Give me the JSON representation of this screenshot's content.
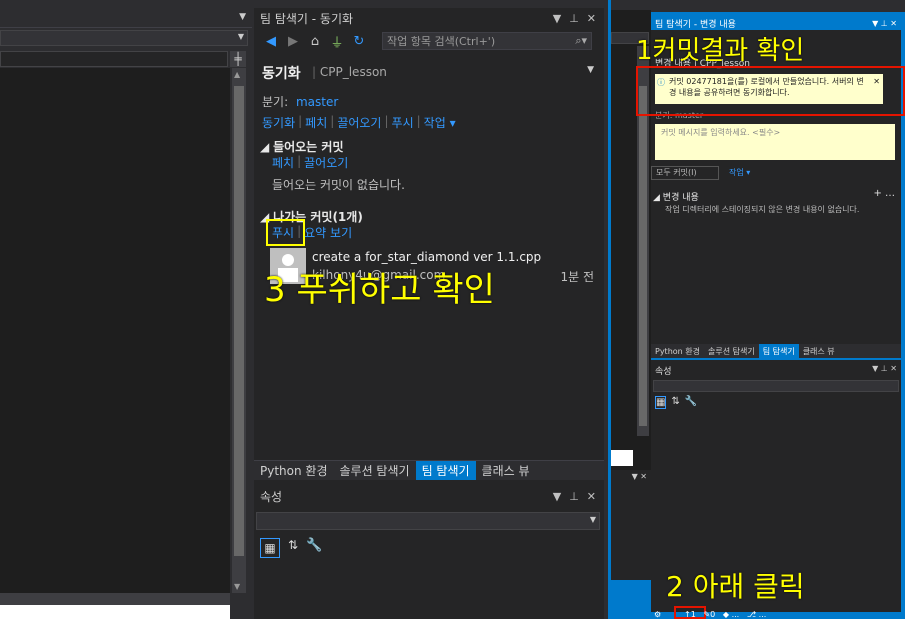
{
  "center": {
    "title": "팀 탐색기 - 동기화",
    "search_placeholder": "작업 항목 검색(Ctrl+')",
    "page_title": "동기화",
    "project": "CPP_lesson",
    "branch_label": "분기:",
    "branch": "master",
    "actions": [
      "동기화",
      "페치",
      "끌어오기",
      "푸시",
      "작업 ▾"
    ],
    "incoming_head": "들어오는 커밋",
    "incoming_actions": [
      "페치",
      "끌어오기"
    ],
    "incoming_empty": "들어오는 커밋이 없습니다.",
    "outgoing_head": "나가는 커밋(1개)",
    "outgoing_actions": [
      "푸시",
      "요약 보기"
    ],
    "commit_message": "create a for_star_diamond ver 1.1.cpp",
    "commit_author": "kilhony4u@gmail.com",
    "commit_time": "1분 전",
    "tabs": [
      "Python 환경",
      "솔루션 탐색기",
      "팀 탐색기",
      "클래스 뷰"
    ],
    "properties_title": "속성"
  },
  "right": {
    "title": "팀 탐색기 - 변경 내용",
    "header": "변경 내용 | CPP_lesson",
    "info_text": "커밋 02477181을(를) 로컬에서 만들었습니다. 서버의 변경 내용을 공유하려면 동기화합니다.",
    "info_commit_link": "02477181",
    "info_sync_link": "동기화",
    "branch_line": "분기: master",
    "commit_placeholder": "커밋 메시지를 입력하세요. <필수>",
    "commit_all_btn": "모두 커밋(I)",
    "actions_btn": "작업 ▾",
    "changes_head": "변경 내용",
    "changes_empty": "작업 디렉터리에 스테이징되지 않은 변경 내용이 없습니다.",
    "tabs": [
      "Python 환경",
      "솔루션 탐색기",
      "팀 탐색기",
      "클래스 뷰"
    ],
    "properties_title": "속성"
  },
  "annotations": {
    "a1": "1커밋결과 확인",
    "a2": "2 아래 클릭",
    "a3": "3 푸쉬하고 확인"
  },
  "colors": {
    "accent": "#007acc",
    "annotation": "#ffff00",
    "link": "#3399ff",
    "highlight": "#e51400"
  }
}
